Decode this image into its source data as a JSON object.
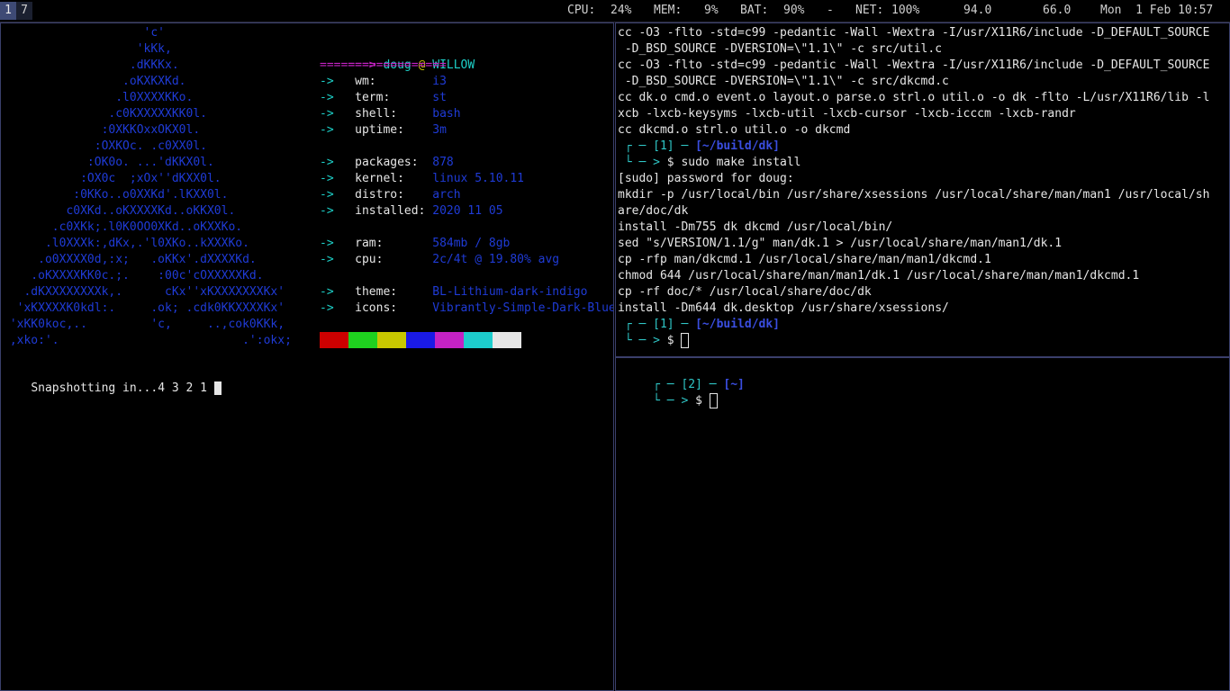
{
  "statusbar": {
    "workspaces": [
      "1",
      "7"
    ],
    "cpu_label": "CPU:",
    "cpu_value": "24%",
    "mem_label": "MEM:",
    "mem_value": "9%",
    "bat_label": "BAT:",
    "bat_value": "90%",
    "sep": "-",
    "net_label": "NET:",
    "net_value": "100%",
    "temp1": "94.0",
    "temp2": "66.0",
    "datetime": "Mon  1 Feb 10:57"
  },
  "fetch": {
    "logo": [
      "                    'c'",
      "                   'kKk,",
      "                  .dKKKx.",
      "                 .oKXKXKd.",
      "                .l0XXXXKKo.",
      "               .c0KXXXXXKK0l.",
      "              :0XKKOxxOKX0l.",
      "             :OXKOc. .c0XX0l.",
      "            :OK0o. ...'dKKX0l.",
      "           :OX0c  ;xOx''dKXX0l.",
      "          :0KKo..o0XXKd'.lKXX0l.",
      "         c0XKd..oKXXXXKd..oKKX0l.",
      "       .c0XKk;.l0K0OO0XKd..oKXXKo.",
      "      .l0XXXk:,dKx,.'l0XKo..kXXXKo.",
      "     .o0XXXX0d,:x;   .oKKx'.dXXXXKd.",
      "    .oKXXXXKK0c.;.    :00c'cOXXXXXKd.",
      "   .dKXXXXXXXXk,.      cKx''xKXXXXXXXKx'",
      "  'xKXXXXK0kdl:.     .ok; .cdk0KKXXXXKx'",
      " 'xKK0koc,..         'c,     ..,cok0KKk,",
      " ,xko:'.                          .':okx;"
    ],
    "user": "doug",
    "at": "@",
    "host": "WILLOW",
    "arrow_head": "===>",
    "separator": "==================",
    "arrow": "->",
    "info": [
      {
        "key": "wm:",
        "value": "i3"
      },
      {
        "key": "term:",
        "value": "st"
      },
      {
        "key": "shell:",
        "value": "bash"
      },
      {
        "key": "uptime:",
        "value": "3m"
      },
      {
        "key": "packages:",
        "value": "878"
      },
      {
        "key": "kernel:",
        "value": "linux 5.10.11"
      },
      {
        "key": "distro:",
        "value": "arch"
      },
      {
        "key": "installed:",
        "value": "2020 11 05"
      },
      {
        "key": "ram:",
        "value": "584mb / 8gb"
      },
      {
        "key": "cpu:",
        "value": "2c/4t @ 19.80% avg"
      },
      {
        "key": "theme:",
        "value": "BL-Lithium-dark-indigo"
      },
      {
        "key": "icons:",
        "value": "Vibrantly-Simple-Dark-Blue"
      }
    ],
    "swatch_colors": [
      "#cc0000",
      "#1fd21f",
      "#c8c800",
      "#1a1ae6",
      "#c422c4",
      "#1dcccc",
      "#e6e6e6"
    ],
    "snapshot_text": "Snapshotting in...4 3 2 1 "
  },
  "term1": {
    "lines": [
      "cc -O3 -flto -std=c99 -pedantic -Wall -Wextra -I/usr/X11R6/include -D_DEFAULT_SOURCE",
      " -D_BSD_SOURCE -DVERSION=\\\"1.1\\\" -c src/util.c",
      "cc -O3 -flto -std=c99 -pedantic -Wall -Wextra -I/usr/X11R6/include -D_DEFAULT_SOURCE",
      " -D_BSD_SOURCE -DVERSION=\\\"1.1\\\" -c src/dkcmd.c",
      "cc dk.o cmd.o event.o layout.o parse.o strl.o util.o -o dk -flto -L/usr/X11R6/lib -l",
      "xcb -lxcb-keysyms -lxcb-util -lxcb-cursor -lxcb-icccm -lxcb-randr",
      "cc dkcmd.o strl.o util.o -o dkcmd"
    ],
    "prompt1_top_a": " ┌ ─ [1] ─ ",
    "prompt1_path": "[~/build/dk]",
    "prompt1_bottom": " └ ─ > ",
    "prompt1_cmd": "$ sudo make install",
    "lines2": [
      "[sudo] password for doug:",
      "mkdir -p /usr/local/bin /usr/share/xsessions /usr/local/share/man/man1 /usr/local/sh",
      "are/doc/dk",
      "install -Dm755 dk dkcmd /usr/local/bin/",
      "sed \"s/VERSION/1.1/g\" man/dk.1 > /usr/local/share/man/man1/dk.1",
      "cp -rfp man/dkcmd.1 /usr/local/share/man/man1/dkcmd.1",
      "chmod 644 /usr/local/share/man/man1/dk.1 /usr/local/share/man/man1/dkcmd.1",
      "cp -rf doc/* /usr/local/share/doc/dk",
      "install -Dm644 dk.desktop /usr/share/xsessions/"
    ],
    "prompt2_top_a": " ┌ ─ [1] ─ ",
    "prompt2_path": "[~/build/dk]",
    "prompt2_bottom": " └ ─ > ",
    "prompt2_cmd": "$ "
  },
  "term2": {
    "prompt_top_a": " ┌ ─ [2] ─ ",
    "prompt_path": "[~]",
    "prompt_bottom": " └ ─ > ",
    "prompt_cmd": "$ "
  }
}
